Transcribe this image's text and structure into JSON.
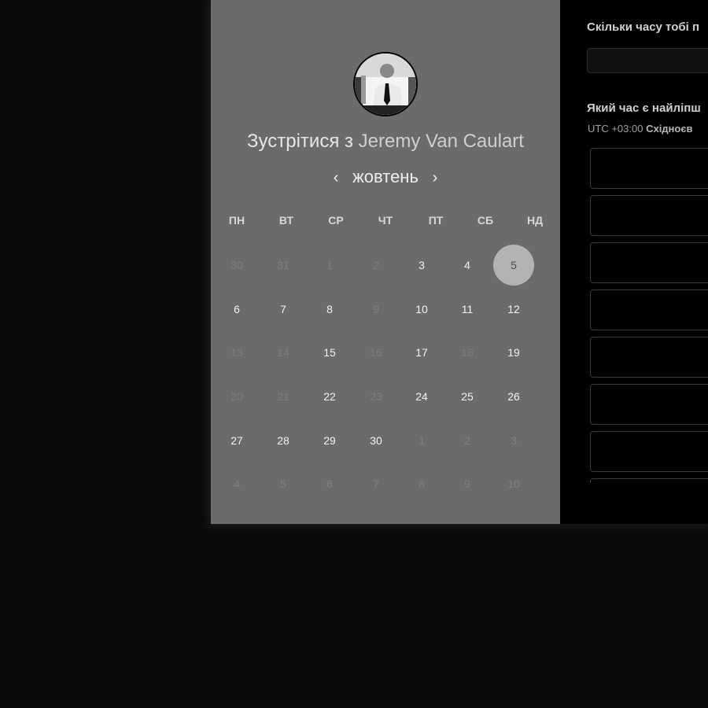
{
  "scheduler": {
    "title_prefix": "Зустрітися з ",
    "host_name": "Jeremy Van Caulart",
    "month_label": "жовтень",
    "prev_month_symbol": "‹",
    "next_month_symbol": "›",
    "weekdays": [
      "ПН",
      "ВТ",
      "СР",
      "ЧТ",
      "ПТ",
      "СБ",
      "НД"
    ],
    "weeks": [
      [
        {
          "d": "30",
          "s": "outside"
        },
        {
          "d": "31",
          "s": "outside"
        },
        {
          "d": "1",
          "s": "unavail"
        },
        {
          "d": "2",
          "s": "unavail"
        },
        {
          "d": "3",
          "s": "avail"
        },
        {
          "d": "4",
          "s": "avail"
        },
        {
          "d": "5",
          "s": "selected"
        }
      ],
      [
        {
          "d": "6",
          "s": "avail"
        },
        {
          "d": "7",
          "s": "avail"
        },
        {
          "d": "8",
          "s": "avail"
        },
        {
          "d": "9",
          "s": "unavail"
        },
        {
          "d": "10",
          "s": "avail"
        },
        {
          "d": "11",
          "s": "avail"
        },
        {
          "d": "12",
          "s": "avail"
        }
      ],
      [
        {
          "d": "13",
          "s": "unavail"
        },
        {
          "d": "14",
          "s": "unavail"
        },
        {
          "d": "15",
          "s": "avail"
        },
        {
          "d": "16",
          "s": "unavail"
        },
        {
          "d": "17",
          "s": "avail"
        },
        {
          "d": "18",
          "s": "unavail"
        },
        {
          "d": "19",
          "s": "avail"
        }
      ],
      [
        {
          "d": "20",
          "s": "unavail"
        },
        {
          "d": "21",
          "s": "unavail"
        },
        {
          "d": "22",
          "s": "avail"
        },
        {
          "d": "23",
          "s": "unavail"
        },
        {
          "d": "24",
          "s": "avail"
        },
        {
          "d": "25",
          "s": "avail"
        },
        {
          "d": "26",
          "s": "avail"
        }
      ],
      [
        {
          "d": "27",
          "s": "avail"
        },
        {
          "d": "28",
          "s": "avail"
        },
        {
          "d": "29",
          "s": "avail"
        },
        {
          "d": "30",
          "s": "avail"
        },
        {
          "d": "1",
          "s": "outside"
        },
        {
          "d": "2",
          "s": "outside"
        },
        {
          "d": "3",
          "s": "outside"
        }
      ],
      [
        {
          "d": "4",
          "s": "outside"
        },
        {
          "d": "5",
          "s": "outside"
        },
        {
          "d": "6",
          "s": "outside"
        },
        {
          "d": "7",
          "s": "outside"
        },
        {
          "d": "8",
          "s": "outside"
        },
        {
          "d": "9",
          "s": "outside"
        },
        {
          "d": "10",
          "s": "outside"
        }
      ]
    ]
  },
  "booking": {
    "duration_question": "Скільки часу тобі п",
    "duration_value": "",
    "time_question": "Який час є найліпш",
    "timezone_offset": "UTC +03:00",
    "timezone_name": "Східноєв",
    "time_slots": [
      "",
      "",
      "",
      "",
      "",
      "",
      "",
      ""
    ]
  },
  "colors": {
    "calendar_panel": "#6b6b6b",
    "selected_day": "#b3b3b3",
    "page_background": "#0a0a0a"
  }
}
